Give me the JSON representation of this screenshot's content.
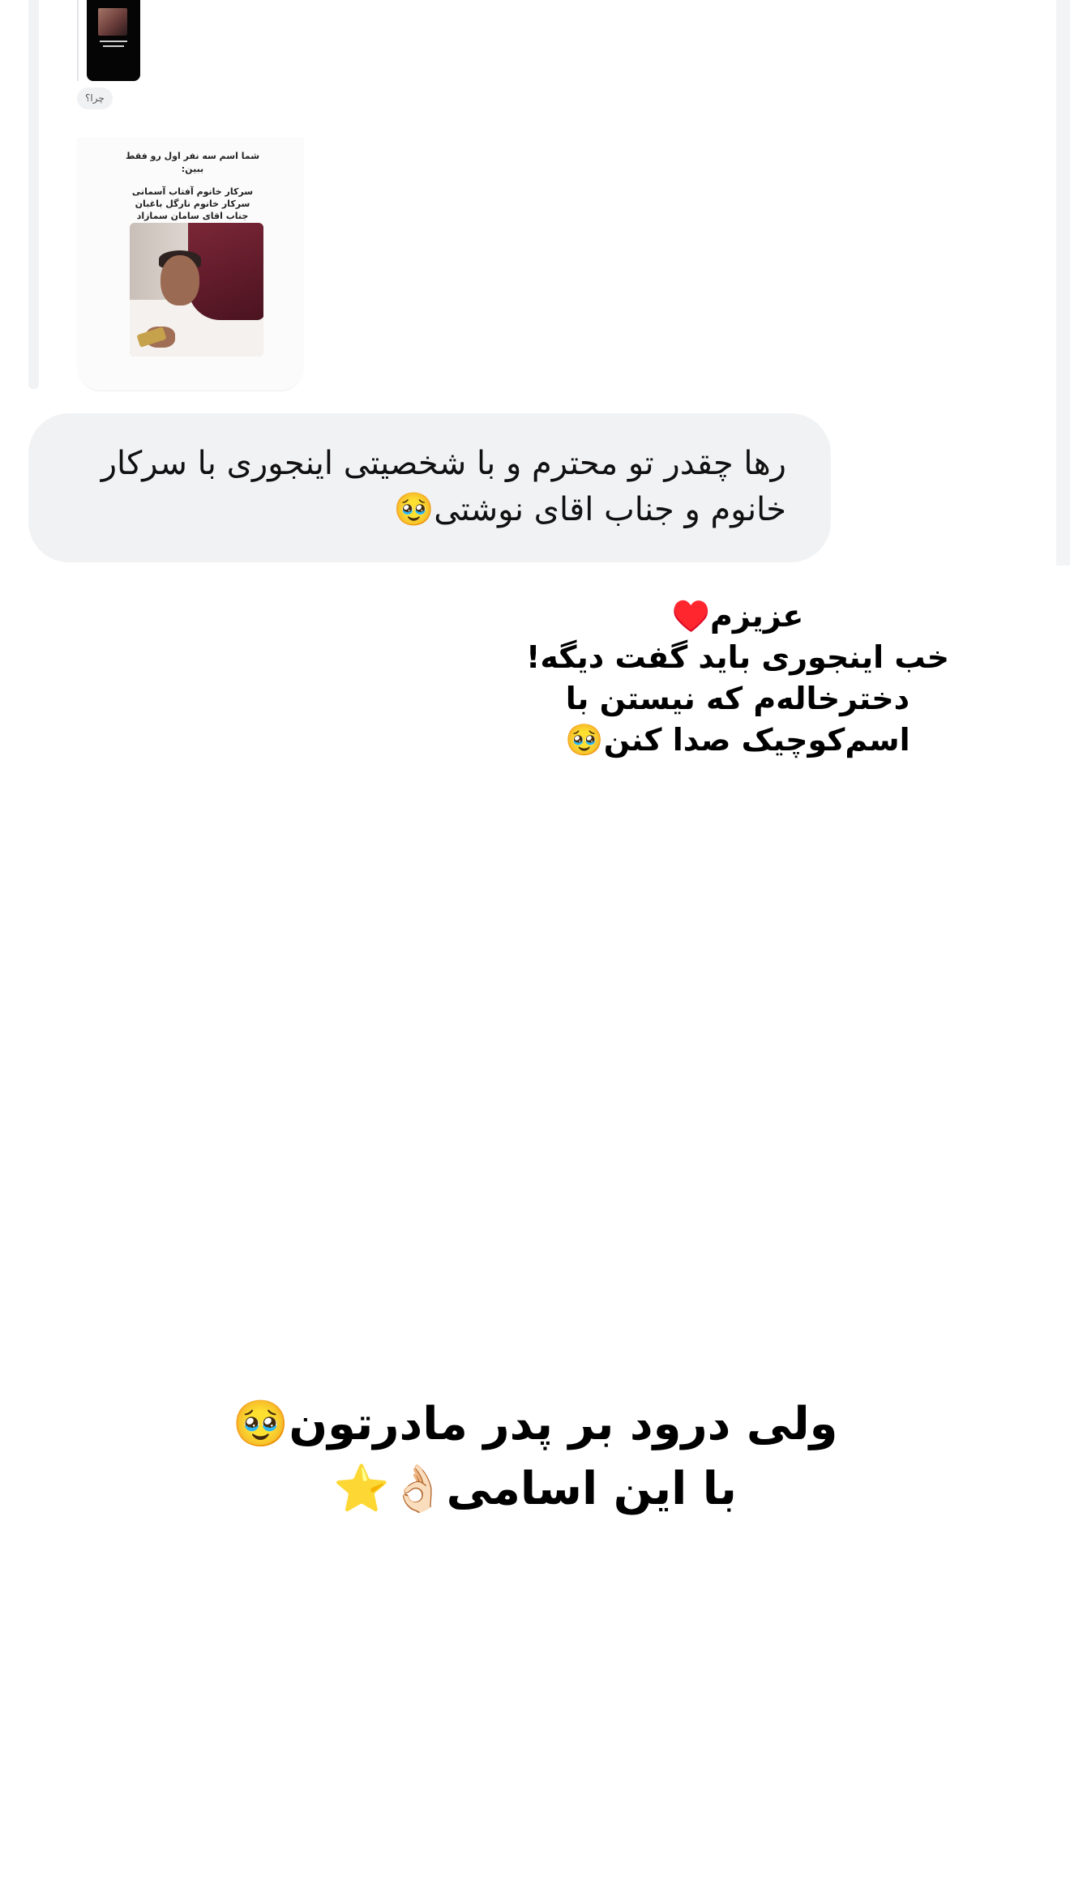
{
  "thread": {
    "story_reply_label": "چرا؟",
    "shared_card": {
      "caption_heading": "شما اسم سه نفر اول رو فقط ببین:",
      "caption_lines": [
        "سرکار خانوم آفتاب آسمانی",
        "سرکار خانوم نارگل باغبان",
        "جناب اقای سامان سمازاد"
      ]
    }
  },
  "message": {
    "text_line_1": "رها چقدر تو محترم و با شخصیتی اینجوری با سرکار",
    "text_line_2": "خانوم و جناب اقای نوشتی🥹"
  },
  "image_text_1": {
    "lines": [
      "عزیزم♥️",
      "خب اینجوری باید گفت دیگه!",
      "دخترخاله‌م که نیستن با",
      "اسم‌کوچیک صدا کنن🥹"
    ]
  },
  "image_text_2": {
    "lines": [
      "ولی درود بر پدر مادرتون🥹",
      "با این اسامی👌🏻⭐"
    ]
  }
}
